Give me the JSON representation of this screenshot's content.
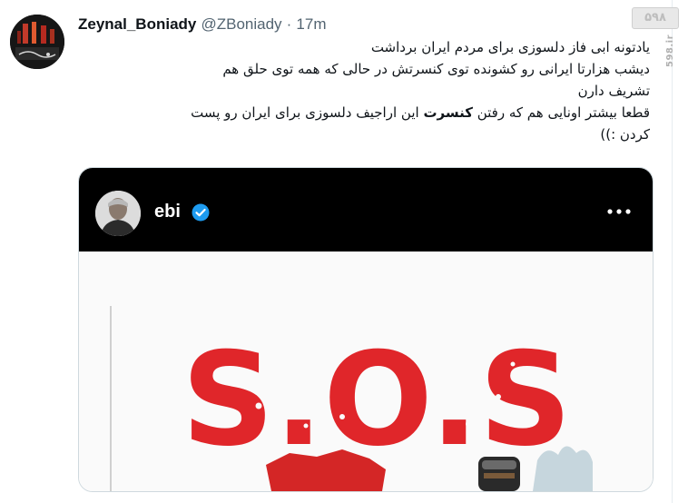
{
  "tweet": {
    "author_name": "Zeynal_Boniady",
    "author_handle": "@ZBoniady",
    "separator": "·",
    "timestamp": "17m",
    "lines": [
      "یادتونه ابی فاز دلسوزی برای مردم ایران برداشت",
      "دیشب هزارتا ایرانی رو کشونده توی کنسرتش در حالی که همه توی حلق هم",
      "تشریف دارن"
    ],
    "line4_prefix": "قطعا بیشتر اونایی هم که رفتن ",
    "line4_bold": "کنسرت",
    "line4_suffix": " این اراجیف دلسوزی برای ایران رو پست",
    "line5": "کردن :))"
  },
  "embedded_post": {
    "username": "ebi",
    "image_text": "S.O.S",
    "colors": {
      "sos_red": "#e0262a",
      "bar_black": "#000000",
      "verified_blue": "#1d9bf0"
    }
  },
  "watermark": {
    "logo": "۵۹۸",
    "site": "598.ir"
  },
  "icons": {
    "verified": "verified-badge-icon",
    "more": "more-horizontal-icon"
  }
}
